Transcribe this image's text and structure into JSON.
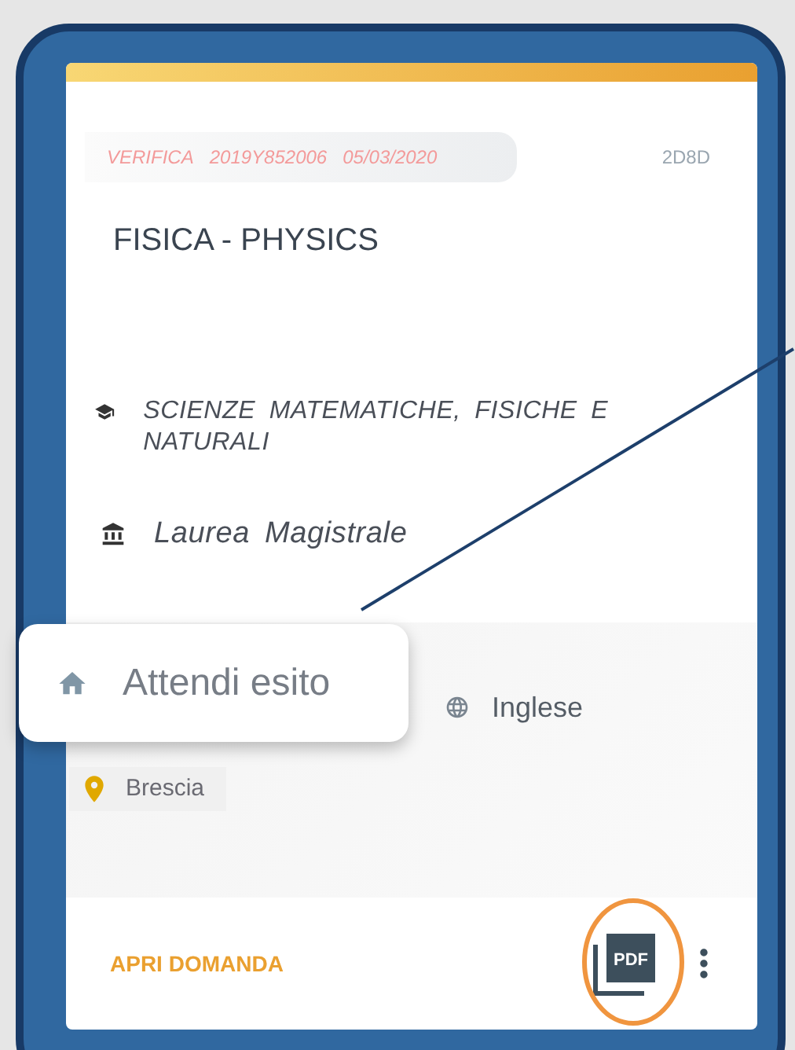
{
  "card": {
    "status_chip": {
      "texts": [
        "VERIFICA",
        "2019Y852006",
        "05/03/2020"
      ]
    },
    "code": "2D8D",
    "title": "FISICA - PHYSICS",
    "faculty": "SCIENZE MATEMATICHE, FISICHE E NATURALI",
    "degree": "Laurea Magistrale",
    "language": "Inglese",
    "location": "Brescia",
    "open_button": "APRI DOMANDA",
    "pdf_icon_label": "PDF"
  },
  "callout": {
    "text": "Attendi esito"
  }
}
